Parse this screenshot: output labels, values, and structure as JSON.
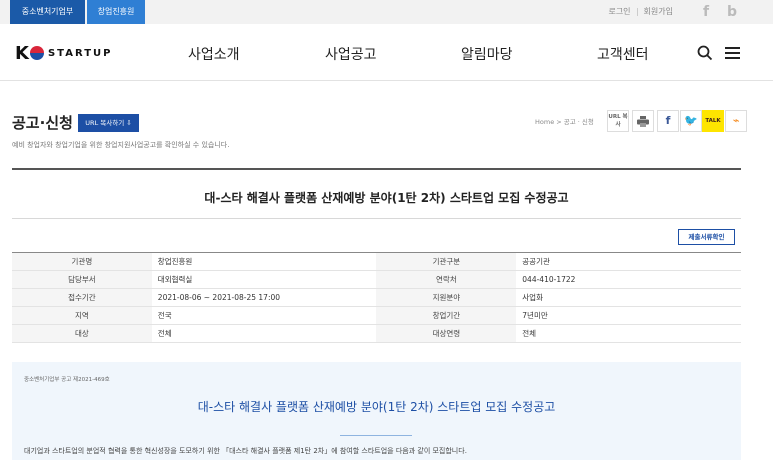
{
  "topbar": {
    "org_tabs": [
      "중소벤처기업부",
      "창업진흥원"
    ],
    "links": [
      "로그인",
      "회원가입"
    ],
    "sns": [
      "f",
      "b"
    ]
  },
  "header": {
    "logo": {
      "text": "STARTUP"
    },
    "nav": [
      "사업소개",
      "사업공고",
      "알림마당",
      "고객센터"
    ]
  },
  "page": {
    "title": "공고·신청",
    "url_copy_label": "URL 복사하기 ⇩",
    "description": "예비 창업자와 창업기업을 위한 창업지원사업공고를 확인하실 수 있습니다.",
    "breadcrumb": "Home > 공고 · 신청",
    "share": {
      "url": "URL 복사",
      "facebook": "f",
      "twitter": "🐦",
      "kakao": "TALK",
      "rss": "⌁"
    }
  },
  "notice": {
    "title": "대-스타 해결사 플랫폼 산재예방 분야(1탄 2차) 스타트업 모집 수정공고",
    "docs_button": "제출서류확인",
    "info": [
      [
        "기관명",
        "창업진흥원",
        "기관구분",
        "공공기관"
      ],
      [
        "담당부서",
        "대외협력실",
        "연락처",
        "044-410-1722"
      ],
      [
        "접수기간",
        "2021-08-06 ~ 2021-08-25 17:00",
        "지원분야",
        "사업화"
      ],
      [
        "지역",
        "전국",
        "창업기간",
        "7년미만"
      ],
      [
        "대상",
        "전체",
        "대상연령",
        "전체"
      ]
    ],
    "body": {
      "doc_number": "중소벤처기업부 공고 제2021-469호",
      "title": "대-스타 해결사 플랫폼 산재예방 분야(1탄 2차) 스타트업 모집 수정공고",
      "text": "대기업과 스타트업의 분업적 협력을 통한 혁신성장을 도모하기 위한 「대스타 해결사 플랫폼 제1탄 2차」에 참여할 스타트업을 다음과 같이 모집합니다."
    }
  }
}
